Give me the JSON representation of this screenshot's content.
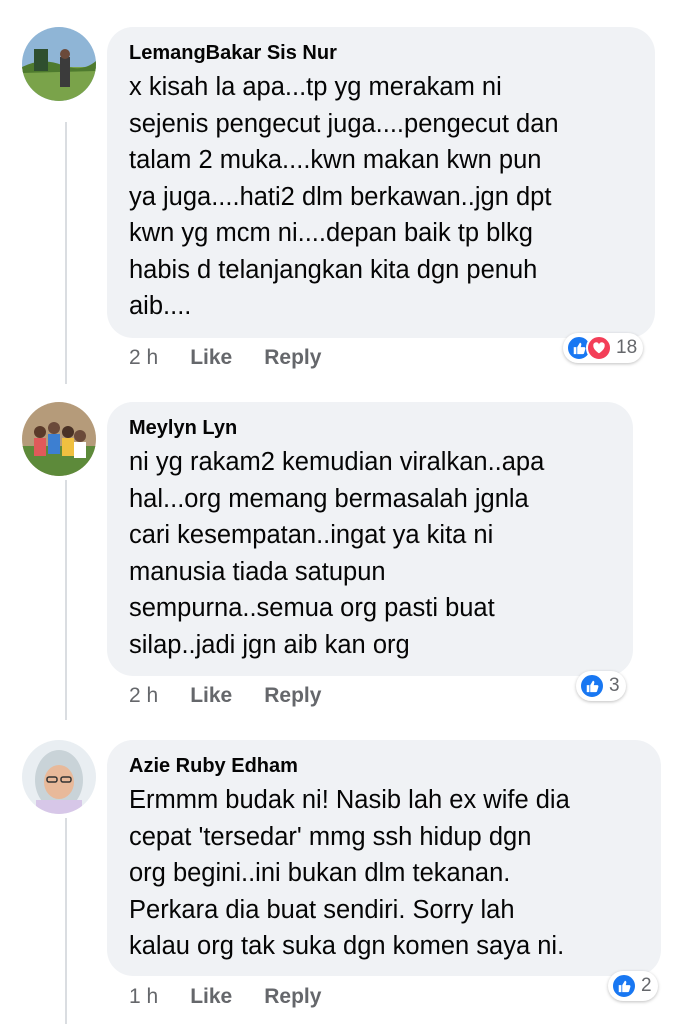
{
  "comments": [
    {
      "author": "LemangBakar Sis Nur",
      "text": "x kisah la apa...tp yg merakam ni\nsejenis pengecut juga....pengecut dan\ntalam 2 muka....kwn makan kwn pun\nya juga....hati2 dlm berkawan..jgn dpt\nkwn yg mcm ni....depan baik tp blkg\nhabis d telanjangkan kita dgn penuh\naib....",
      "time": "2 h",
      "like_label": "Like",
      "reply_label": "Reply",
      "reaction_count": "18",
      "reaction_icons": [
        "like-icon",
        "love-icon"
      ]
    },
    {
      "author": "Meylyn Lyn",
      "text": "ni yg rakam2 kemudian viralkan..apa\nhal...org memang bermasalah jgnla\ncari kesempatan..ingat ya kita ni\nmanusia tiada satupun\nsempurna..semua org pasti buat\nsilap..jadi jgn aib kan org",
      "time": "2 h",
      "like_label": "Like",
      "reply_label": "Reply",
      "reaction_count": "3",
      "reaction_icons": [
        "like-icon"
      ]
    },
    {
      "author": "Azie Ruby Edham",
      "text": "Ermmm budak ni! Nasib lah ex wife dia\ncepat 'tersedar' mmg ssh hidup dgn\norg begini..ini bukan dlm tekanan.\nPerkara dia buat sendiri. Sorry lah\nkalau org tak suka dgn komen saya ni.",
      "time": "1 h",
      "like_label": "Like",
      "reply_label": "Reply",
      "reaction_count": "2",
      "reaction_icons": [
        "like-icon"
      ]
    }
  ],
  "colors": {
    "bubble": "#f0f2f5",
    "meta_text": "#65676b",
    "like_blue": "#1877f2",
    "love_red": "#f33e58"
  }
}
